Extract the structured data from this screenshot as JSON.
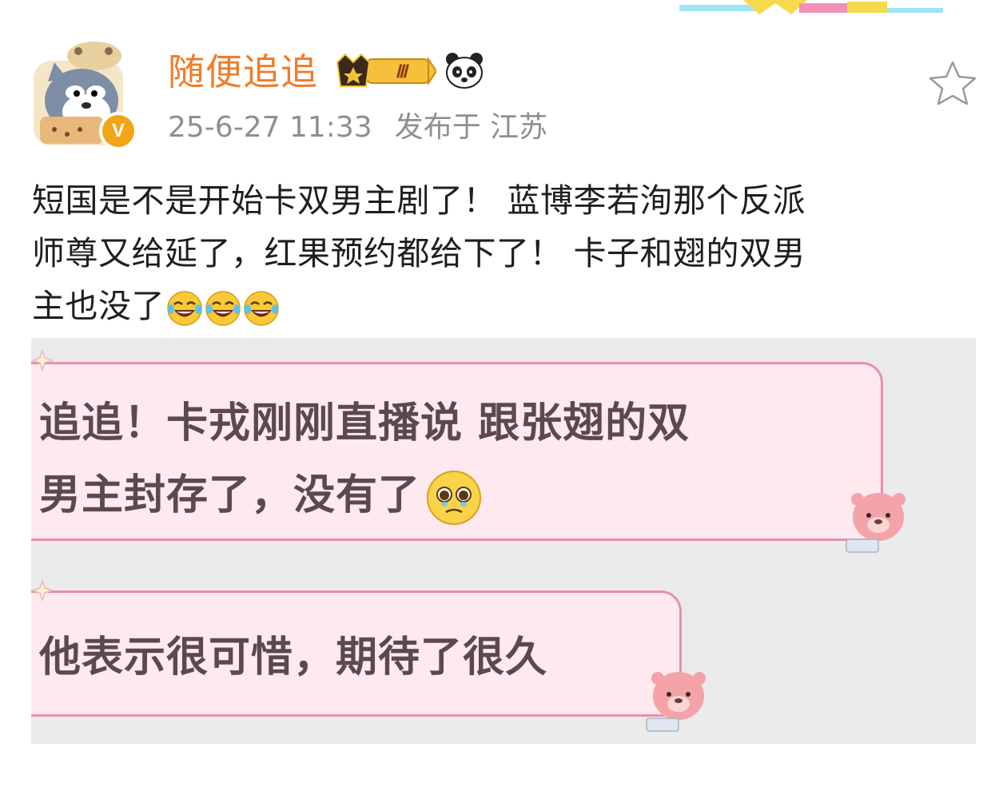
{
  "post": {
    "username": "随便追追",
    "vip_level": "Ⅲ",
    "verified_mark": "V",
    "timestamp": "25-6-27 11:33",
    "location": "发布于 江苏",
    "text_line1": "短国是不是开始卡双男主剧了！ 蓝博李若洵那个反派",
    "text_line2": "师尊又给延了，红果预约都给下了！ 卡子和翅的双男",
    "text_line3": "主也没了",
    "text_emoji": "laughing-crying-emoji"
  },
  "embedded_image": {
    "bubble1_line1": "追追！卡戎刚刚直播说 跟张翅的双",
    "bubble1_line2": "男主封存了，没有了",
    "bubble2_text": "他表示很可惜，期待了很久",
    "bubble_fill": "#fde9ee",
    "bubble_border": "#e98fa8"
  },
  "colors": {
    "username": "#f07c28",
    "meta": "#8f8f8f",
    "text": "#1e1e1e",
    "verified_badge": "#f2a516"
  }
}
